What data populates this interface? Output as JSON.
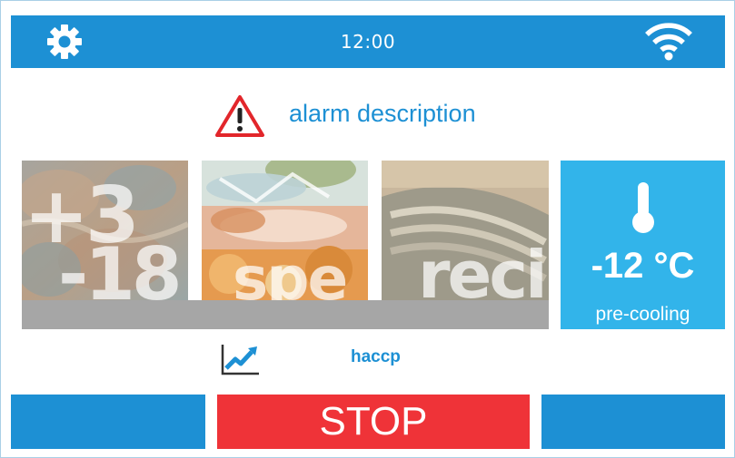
{
  "header": {
    "time": "12:00",
    "settings_icon": "gear-icon",
    "wifi_icon": "wifi-icon"
  },
  "alarm": {
    "icon": "warning-triangle-icon",
    "text": "alarm description"
  },
  "tiles": [
    {
      "name": "temperature-mode",
      "label_top": "+3",
      "label_bottom": "-18"
    },
    {
      "name": "special-mode",
      "label": "spe"
    },
    {
      "name": "recipes-mode",
      "label": "reci"
    }
  ],
  "temperature": {
    "icon": "thermometer-icon",
    "value": "-12 °C",
    "status": "pre-cooling"
  },
  "haccp": {
    "icon": "trend-chart-icon",
    "label": "haccp"
  },
  "footer": {
    "stop_label": "STOP"
  },
  "colors": {
    "primary_blue": "#1d90d4",
    "light_blue": "#32b4ea",
    "stop_red": "#ef3338",
    "alarm_red": "#e2262b",
    "gray_bar": "#a6a6a6"
  }
}
